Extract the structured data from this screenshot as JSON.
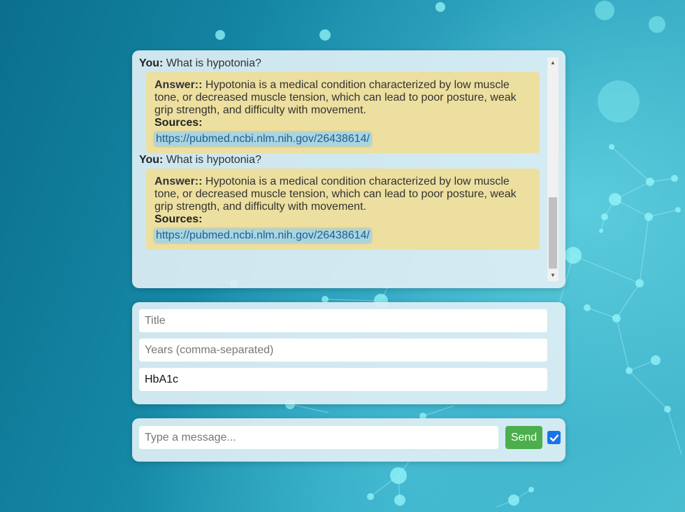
{
  "chat": {
    "messages": [
      {
        "you_label": "You:",
        "question": "What is hypotonia?",
        "answer_label": "Answer::",
        "answer": "Hypotonia is a medical condition characterized by low muscle tone, or decreased muscle tension, which can lead to poor posture, weak grip strength, and difficulty with movement.",
        "sources_label": "Sources:",
        "source_link": "https://pubmed.ncbi.nlm.nih.gov/26438614/"
      },
      {
        "you_label": "You:",
        "question": "What is hypotonia?",
        "answer_label": "Answer::",
        "answer": "Hypotonia is a medical condition characterized by low muscle tone, or decreased muscle tension, which can lead to poor posture, weak grip strength, and difficulty with movement.",
        "sources_label": "Sources:",
        "source_link": "https://pubmed.ncbi.nlm.nih.gov/26438614/"
      }
    ]
  },
  "filters": {
    "title_placeholder": "Title",
    "years_placeholder": "Years (comma-separated)",
    "keyword_value": "HbA1c"
  },
  "composer": {
    "placeholder": "Type a message...",
    "send_label": "Send",
    "checkbox_checked": true
  },
  "colors": {
    "answer_bubble": "#ecdf9f",
    "send_button": "#4cae4c",
    "checkbox": "#1a73e8",
    "link_highlight": "#a9d4e2"
  },
  "icons": {
    "checkbox": "check-icon",
    "scroll_up": "triangle-up-icon",
    "scroll_down": "triangle-down-icon"
  }
}
